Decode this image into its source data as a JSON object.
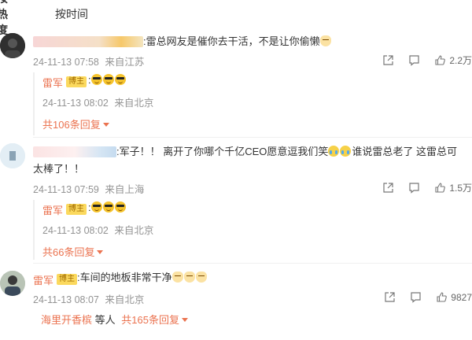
{
  "tabs": {
    "hot": "按热度",
    "time": "按时间"
  },
  "comments": [
    {
      "text_suffix": ":雷总网友是催你去干活，不是让你偷懒",
      "time": "24-11-13 07:58",
      "location": "来自江苏",
      "likes": "2.2万",
      "reply": {
        "name": "雷军",
        "badge": "博主",
        "text_prefix": ":",
        "time": "24-11-13 08:02",
        "location": "来自北京"
      },
      "more": "共106条回复"
    },
    {
      "text_line1": ":军子！！ 离开了你哪个千亿CEO愿意逗我们笑",
      "text_line1b": "谁说雷总老了 这雷总可",
      "text_line2": "太棒了！！",
      "time": "24-11-13 07:59",
      "location": "来自上海",
      "likes": "1.5万",
      "reply": {
        "name": "雷军",
        "badge": "博主",
        "text_prefix": ":",
        "time": "24-11-13 08:02",
        "location": "来自北京"
      },
      "more": "共66条回复"
    },
    {
      "name": "雷军",
      "badge": "博主",
      "text": ":车间的地板非常干净",
      "time": "24-11-13 08:07",
      "location": "来自北京",
      "likes": "9827",
      "reply_user": "海里开香槟",
      "reply_others": "等人",
      "more": "共165条回复"
    }
  ],
  "colors": {
    "accent": "#eb7350",
    "meta": "#939393",
    "badge": "#fbd95e"
  }
}
